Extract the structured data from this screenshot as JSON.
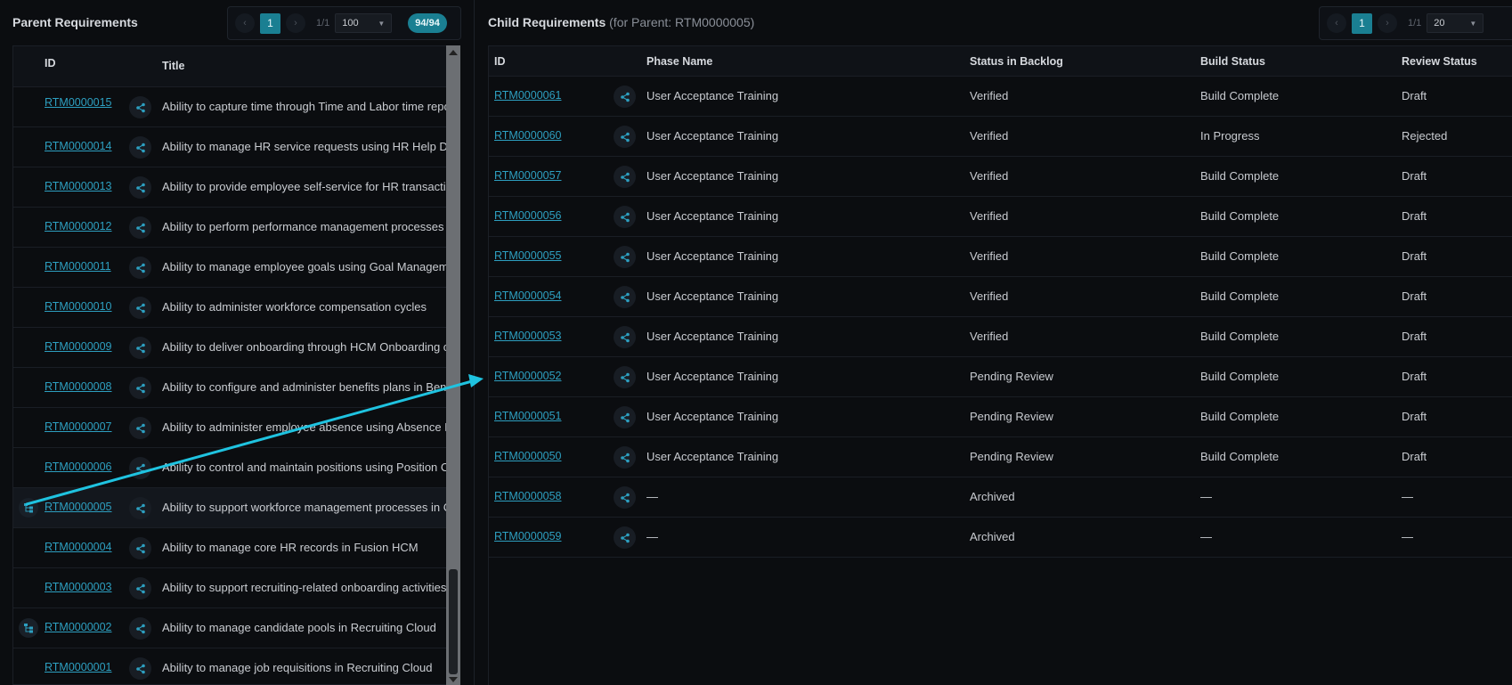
{
  "parent": {
    "title": "Parent Requirements",
    "pager": {
      "prev": "‹",
      "current": "1",
      "next": "›",
      "of": "1/1",
      "page_size": "100",
      "count_badge": "94/94"
    },
    "columns": {
      "id": "ID",
      "title": "Title"
    },
    "rows": [
      {
        "id": "RTM0000015",
        "title": "Ability to capture time through Time and Labor time repo"
      },
      {
        "id": "RTM0000014",
        "title": "Ability to manage HR service requests using HR Help De"
      },
      {
        "id": "RTM0000013",
        "title": "Ability to provide employee self-service for HR transactio"
      },
      {
        "id": "RTM0000012",
        "title": "Ability to perform performance management processes"
      },
      {
        "id": "RTM0000011",
        "title": "Ability to manage employee goals using Goal Manageme"
      },
      {
        "id": "RTM0000010",
        "title": "Ability to administer workforce compensation cycles"
      },
      {
        "id": "RTM0000009",
        "title": "Ability to deliver onboarding through HCM Onboarding c"
      },
      {
        "id": "RTM0000008",
        "title": "Ability to configure and administer benefits plans in Ben"
      },
      {
        "id": "RTM0000007",
        "title": "Ability to administer employee absence using Absence M"
      },
      {
        "id": "RTM0000006",
        "title": "Ability to control and maintain positions using Position C"
      },
      {
        "id": "RTM0000005",
        "title": "Ability to support workforce management processes in C",
        "selected": true,
        "has_children": true
      },
      {
        "id": "RTM0000004",
        "title": "Ability to manage core HR records in Fusion HCM"
      },
      {
        "id": "RTM0000003",
        "title": "Ability to support recruiting-related onboarding activities"
      },
      {
        "id": "RTM0000002",
        "title": "Ability to manage candidate pools in Recruiting Cloud",
        "has_children": true
      },
      {
        "id": "RTM0000001",
        "title": "Ability to manage job requisitions in Recruiting Cloud"
      }
    ]
  },
  "child": {
    "title": "Child Requirements",
    "subtitle": "(for Parent: RTM0000005)",
    "pager": {
      "prev": "‹",
      "current": "1",
      "next": "›",
      "of": "1/1",
      "page_size": "20"
    },
    "columns": {
      "id": "ID",
      "phase": "Phase Name",
      "status": "Status in Backlog",
      "build": "Build Status",
      "review": "Review Status"
    },
    "rows": [
      {
        "id": "RTM0000061",
        "phase": "User Acceptance Training",
        "status": "Verified",
        "build": "Build Complete",
        "review": "Draft"
      },
      {
        "id": "RTM0000060",
        "phase": "User Acceptance Training",
        "status": "Verified",
        "build": "In Progress",
        "review": "Rejected"
      },
      {
        "id": "RTM0000057",
        "phase": "User Acceptance Training",
        "status": "Verified",
        "build": "Build Complete",
        "review": "Draft"
      },
      {
        "id": "RTM0000056",
        "phase": "User Acceptance Training",
        "status": "Verified",
        "build": "Build Complete",
        "review": "Draft"
      },
      {
        "id": "RTM0000055",
        "phase": "User Acceptance Training",
        "status": "Verified",
        "build": "Build Complete",
        "review": "Draft"
      },
      {
        "id": "RTM0000054",
        "phase": "User Acceptance Training",
        "status": "Verified",
        "build": "Build Complete",
        "review": "Draft"
      },
      {
        "id": "RTM0000053",
        "phase": "User Acceptance Training",
        "status": "Verified",
        "build": "Build Complete",
        "review": "Draft"
      },
      {
        "id": "RTM0000052",
        "phase": "User Acceptance Training",
        "status": "Pending Review",
        "build": "Build Complete",
        "review": "Draft"
      },
      {
        "id": "RTM0000051",
        "phase": "User Acceptance Training",
        "status": "Pending Review",
        "build": "Build Complete",
        "review": "Draft"
      },
      {
        "id": "RTM0000050",
        "phase": "User Acceptance Training",
        "status": "Pending Review",
        "build": "Build Complete",
        "review": "Draft"
      },
      {
        "id": "RTM0000058",
        "phase": "—",
        "status": "Archived",
        "build": "—",
        "review": "—"
      },
      {
        "id": "RTM0000059",
        "phase": "—",
        "status": "Archived",
        "build": "—",
        "review": "—"
      }
    ]
  },
  "icons": {
    "share": "share-icon",
    "hierarchy": "hierarchy-icon",
    "caret": "caret-down-icon"
  },
  "colors": {
    "accent": "#1a7f92",
    "link": "#2d9fc0",
    "annotation_arrow": "#1fc3e0"
  }
}
